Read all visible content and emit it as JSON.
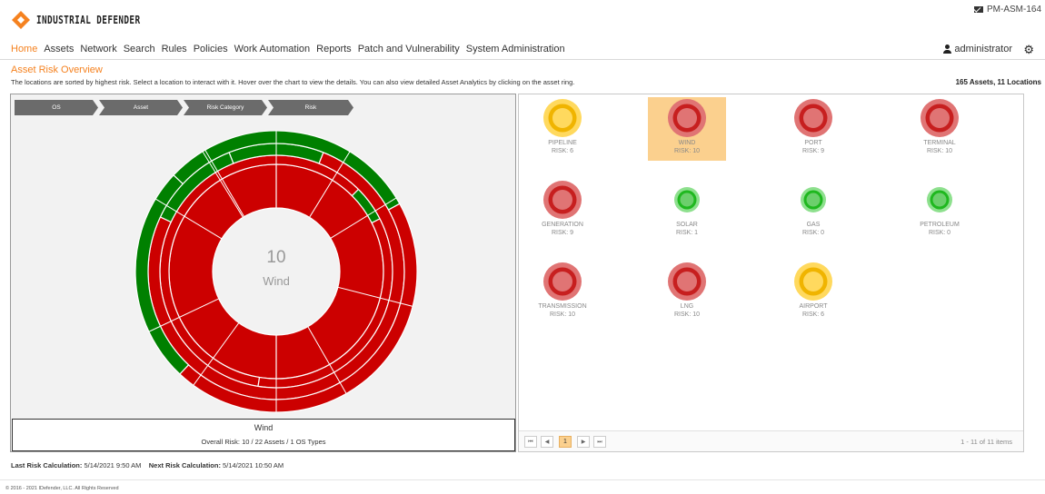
{
  "header": {
    "logo_text": "INDUSTRIAL DEFENDER",
    "server_name": "PM-ASM-164",
    "icons": {
      "logo": "diamond-logo-icon",
      "mail": "envelope-icon",
      "user": "user-icon",
      "settings": "gear-icon"
    }
  },
  "nav": {
    "items": [
      {
        "label": "Home",
        "active": true
      },
      {
        "label": "Assets"
      },
      {
        "label": "Network"
      },
      {
        "label": "Search"
      },
      {
        "label": "Rules"
      },
      {
        "label": "Policies"
      },
      {
        "label": "Work Automation"
      },
      {
        "label": "Reports"
      },
      {
        "label": "Patch and Vulnerability"
      },
      {
        "label": "System Administration"
      }
    ],
    "user_name": "administrator"
  },
  "page": {
    "title": "Asset Risk Overview",
    "description": "The locations are sorted by highest risk. Select a location to interact with it. Hover over the chart to view the details. You can also view detailed Asset Analytics by clicking on the asset ring.",
    "summary": "165 Assets, 11 Locations"
  },
  "chart": {
    "breadcrumbs": [
      "OS",
      "Asset",
      "Risk Category",
      "Risk"
    ],
    "center_value": "10",
    "center_label": "Wind",
    "colors": {
      "high": "#cc0000",
      "low": "#008000"
    }
  },
  "chart_data": {
    "type": "sunburst",
    "center_value": 10,
    "center_label": "Wind",
    "levels": [
      "OS",
      "Asset",
      "Risk Category",
      "Risk"
    ],
    "rings": [
      {
        "level": "OS",
        "segments": [
          {
            "status": "high",
            "fraction": 1.0
          }
        ]
      },
      {
        "level": "Asset",
        "segments": [
          {
            "status": "high",
            "fraction": 0.6
          },
          {
            "status": "low",
            "fraction": 0.05
          },
          {
            "status": "high",
            "fraction": 0.35
          }
        ]
      },
      {
        "level": "Risk Category",
        "segments": [
          {
            "status": "low",
            "fraction": 0.12
          },
          {
            "status": "high",
            "fraction": 0.76
          },
          {
            "status": "low",
            "fraction": 0.12
          }
        ]
      },
      {
        "level": "Risk",
        "segments": [
          {
            "status": "low",
            "fraction": 0.3
          },
          {
            "status": "high",
            "fraction": 0.45
          },
          {
            "status": "low",
            "fraction": 0.25
          }
        ]
      }
    ]
  },
  "info": {
    "title": "Wind",
    "detail": "Overall Risk: 10 / 22  Assets / 1 OS Types"
  },
  "locations": [
    {
      "name": "PIPELINE",
      "risk": "RISK: 6",
      "level": "medium",
      "selected": false
    },
    {
      "name": "WIND",
      "risk": "RISK: 10",
      "level": "high",
      "selected": true
    },
    {
      "name": "PORT",
      "risk": "RISK: 9",
      "level": "high",
      "selected": false
    },
    {
      "name": "TERMINAL",
      "risk": "RISK: 10",
      "level": "high",
      "selected": false
    },
    {
      "name": "GENERATION",
      "risk": "RISK: 9",
      "level": "high",
      "selected": false
    },
    {
      "name": "SOLAR",
      "risk": "RISK: 1",
      "level": "low",
      "selected": false
    },
    {
      "name": "GAS",
      "risk": "RISK: 0",
      "level": "low",
      "selected": false
    },
    {
      "name": "PETROLEUM",
      "risk": "RISK: 0",
      "level": "low",
      "selected": false
    },
    {
      "name": "TRANSMISSION",
      "risk": "RISK: 10",
      "level": "high",
      "selected": false
    },
    {
      "name": "LNG",
      "risk": "RISK: 10",
      "level": "high",
      "selected": false
    },
    {
      "name": "AIRPORT",
      "risk": "RISK: 6",
      "level": "medium",
      "selected": false
    }
  ],
  "risk_colors": {
    "high": {
      "outer": "#e07474",
      "ring": "#c71f1f",
      "inner": "#e07474"
    },
    "medium": {
      "outer": "#ffd95e",
      "ring": "#f0b400",
      "inner": "#ffd95e"
    },
    "low": {
      "outer": "#8ee08e",
      "ring": "#1fb81f",
      "inner": "#6ccf6c"
    }
  },
  "pager": {
    "first": "⏮",
    "prev": "◀",
    "current_page": "1",
    "next": "▶",
    "last": "⏭",
    "info": "1 - 11 of 11 items"
  },
  "calc": {
    "last_label": "Last Risk Calculation:",
    "last_value": "5/14/2021 9:50 AM",
    "next_label": "Next Risk Calculation:",
    "next_value": "5/14/2021 10:50 AM"
  },
  "footer": {
    "copyright": "© 2016 - 2021 IDefender, LLC. All Rights Reserved"
  }
}
